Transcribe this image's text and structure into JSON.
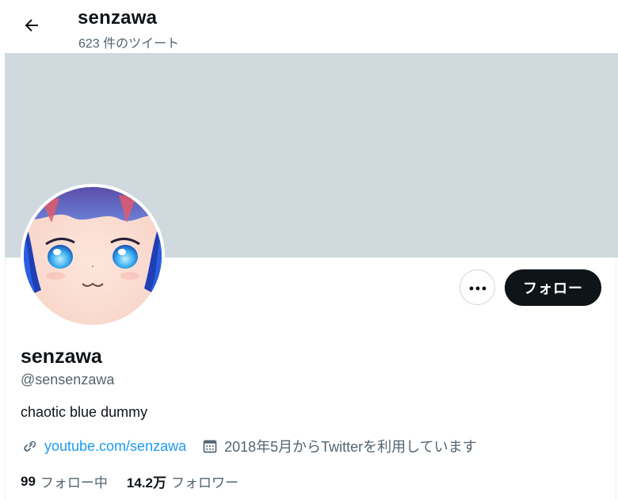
{
  "header": {
    "display_name": "senzawa",
    "tweet_count": "623 件のツイート",
    "back_icon": "arrow-left-icon"
  },
  "banner": {
    "color": "#cfd9de"
  },
  "profile": {
    "display_name": "senzawa",
    "handle": "@sensenzawa",
    "bio": "chaotic blue dummy",
    "link": "youtube.com/senzawa",
    "joined": "2018年5月からTwitterを利用しています",
    "link_icon": "link-icon",
    "calendar_icon": "calendar-icon"
  },
  "actions": {
    "more_icon": "more-dots-icon",
    "follow_label": "フォロー"
  },
  "stats": {
    "following_count": "99",
    "following_label": "フォロー中",
    "followers_count": "14.2万",
    "followers_label": "フォロワー"
  },
  "colors": {
    "accent": "#1d9bf0",
    "text": "#0f1419",
    "secondary": "#536471",
    "button_dark": "#0f1419"
  }
}
